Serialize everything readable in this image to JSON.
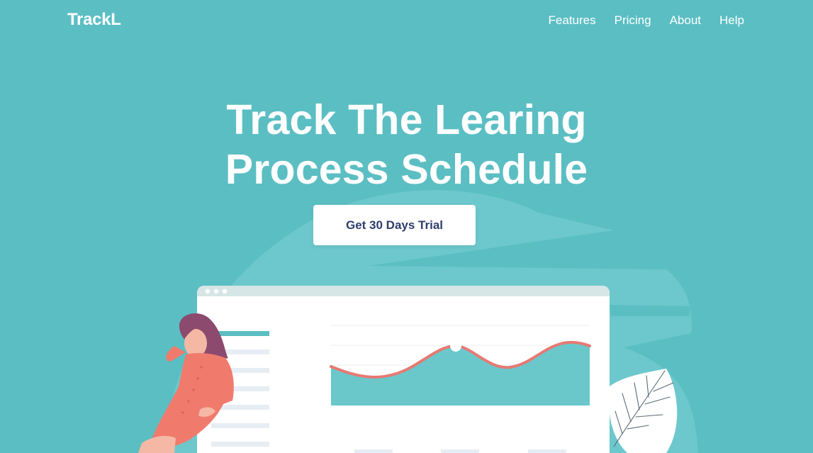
{
  "colors": {
    "background": "#5bbec3",
    "background_shape": "#6cc8cc",
    "white": "#ffffff",
    "cta_text": "#2e3d6b",
    "chart_line": "#e57a73",
    "chart_fill": "#6ac8cb",
    "window_bar": "#d6e6e6",
    "sidebar_accent": "#5bbec3",
    "sidebar_rows": "#e6edf4",
    "person_dress": "#f07b6d",
    "person_hair": "#8c4a6e",
    "person_skin": "#f5b8a4"
  },
  "nav": {
    "logo": "TrackL",
    "links": [
      {
        "label": "Features"
      },
      {
        "label": "Pricing"
      },
      {
        "label": "About"
      },
      {
        "label": "Help"
      }
    ]
  },
  "hero": {
    "title_line1": "Track The Learing",
    "title_line2": "Process Schedule",
    "cta_label": "Get 30 Days Trial"
  }
}
